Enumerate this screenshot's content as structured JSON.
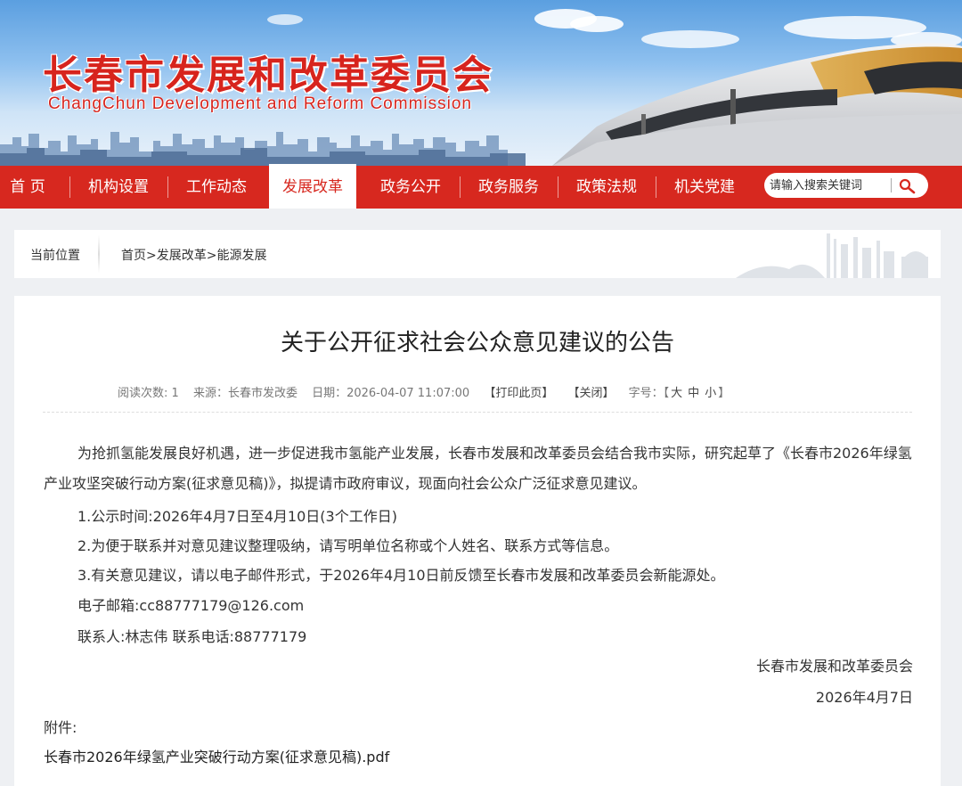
{
  "header": {
    "title_cn": "长春市发展和改革委员会",
    "title_en": "ChangChun Development and Reform Commission"
  },
  "nav": {
    "items": [
      {
        "label": "首  页",
        "active": false
      },
      {
        "label": "机构设置",
        "active": false
      },
      {
        "label": "工作动态",
        "active": false
      },
      {
        "label": "发展改革",
        "active": true
      },
      {
        "label": "政务公开",
        "active": false
      },
      {
        "label": "政务服务",
        "active": false
      },
      {
        "label": "政策法规",
        "active": false
      },
      {
        "label": "机关党建",
        "active": false
      }
    ],
    "search_placeholder": "请输入搜索关键词"
  },
  "breadcrumb": {
    "label": "当前位置",
    "path": "首页>发展改革>能源发展"
  },
  "article": {
    "title": "关于公开征求社会公众意见建议的公告",
    "meta": {
      "reads": "阅读次数:  1",
      "source": "来源：长春市发改委",
      "date": "日期：2026-04-07 11:07:00",
      "print": "【打印此页】",
      "close": "【关闭】",
      "font_label": "字号：",
      "font_open": "【",
      "font_large": "大",
      "font_medium": "中",
      "font_small": "小",
      "font_close": "】"
    },
    "intro": "为抢抓氢能发展良好机遇，进一步促进我市氢能产业发展，长春市发展和改革委员会结合我市实际，研究起草了《长春市2026年绿氢产业攻坚突破行动方案(征求意见稿)》，拟提请市政府审议，现面向社会公众广泛征求意见建议。",
    "items": [
      "1.公示时间:2026年4月7日至4月10日(3个工作日)",
      "2.为便于联系并对意见建议整理吸纳，请写明单位名称或个人姓名、联系方式等信息。",
      "3.有关意见建议，请以电子邮件形式，于2026年4月10日前反馈至长春市发展和改革委员会新能源处。",
      "电子邮箱:cc88777179@126.com",
      "联系人:林志伟  联系电话:88777179"
    ],
    "signature": "长春市发展和改革委员会",
    "sign_date": "2026年4月7日",
    "attachment_label": "附件:",
    "attachment_link": "长春市2026年绿氢产业突破行动方案(征求意见稿).pdf"
  },
  "colors": {
    "brand_red": "#d7281f",
    "title_red": "#d7241d"
  }
}
